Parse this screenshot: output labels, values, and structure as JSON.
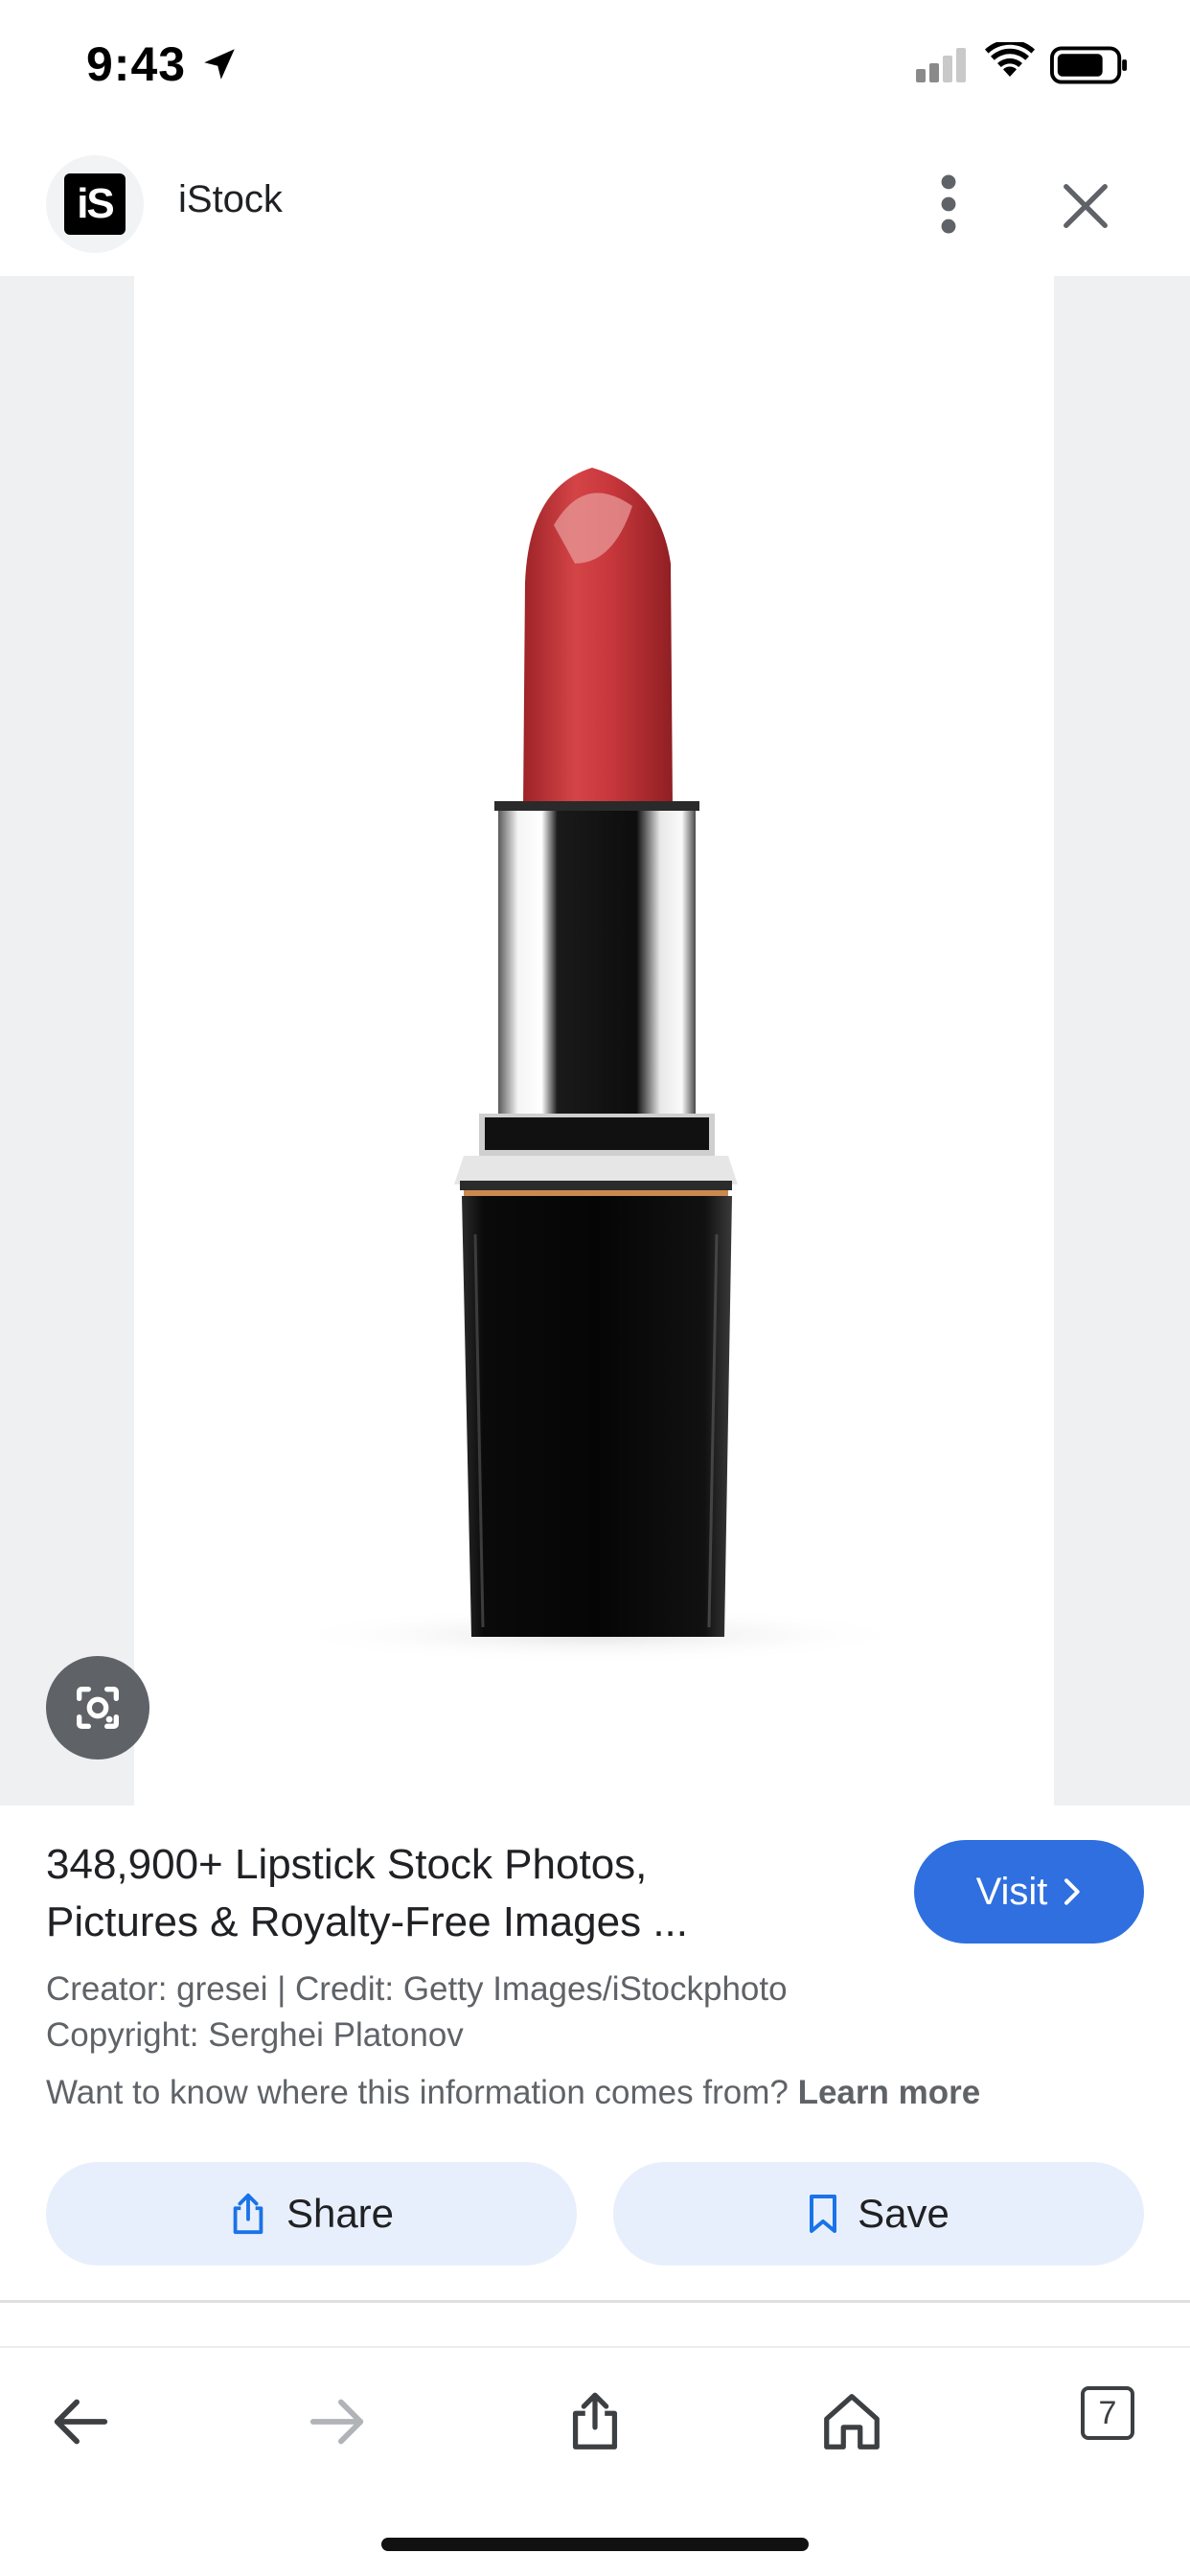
{
  "status_bar": {
    "time": "9:43"
  },
  "header": {
    "site_name": "iStock",
    "logo_text": "iS"
  },
  "result": {
    "title_line1": "348,900+ Lipstick Stock Photos,",
    "title_line2": "Pictures & Royalty-Free Images ...",
    "visit_label": "Visit",
    "meta_line1": "Creator: gresei | Credit: Getty Images/iStockphoto",
    "meta_line2": "Copyright: Serghei Platonov",
    "meta_question": "Want to know where this information comes from?",
    "learn_more": "Learn more"
  },
  "actions": {
    "share_label": "Share",
    "save_label": "Save"
  },
  "toolbar": {
    "tabs_count": "7"
  },
  "colors": {
    "accent": "#2f6fe0",
    "action_bg": "#e8effc",
    "lipstick_red": "#c6363b"
  }
}
